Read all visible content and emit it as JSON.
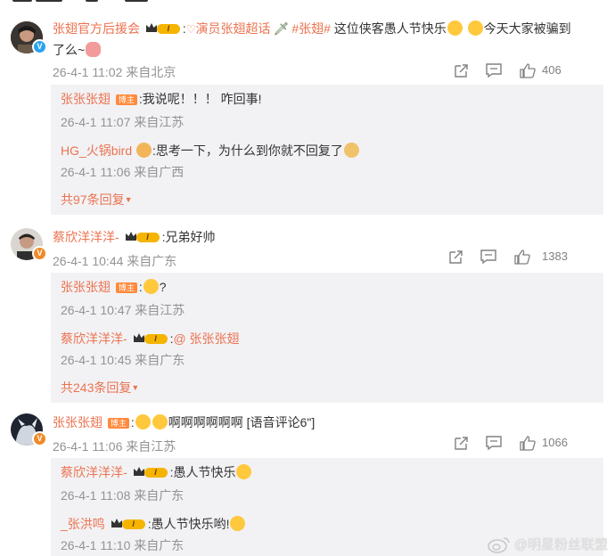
{
  "comments": [
    {
      "user": "张翅官方后援会",
      "text_parts": {
        "colon": ":",
        "tag1": "演员张翅超话",
        "tag2": "#张翅#",
        "t1": " 这位侠客愚人节快乐",
        "t2": "今天大家被骗到",
        "t3": "了么~"
      },
      "time": "26-4-1 11:02",
      "location": "来自北京",
      "likes": "406",
      "replies": [
        {
          "user": "张张张翅",
          "badge": "博主",
          "text": ":我说呢！！！ 咋回事!",
          "time": "26-4-1 11:07",
          "location": "来自江苏"
        },
        {
          "user": "HG_火锅bird",
          "text": ":思考一下，为什么到你就不回复了",
          "time": "26-4-1 11:06",
          "location": "来自广西"
        }
      ],
      "more": "共97条回复"
    },
    {
      "user": "蔡欣洋洋洋-",
      "text": ":兄弟好帅",
      "time": "26-4-1 10:44",
      "location": "来自广东",
      "likes": "1383",
      "replies": [
        {
          "user": "张张张翅",
          "badge": "博主",
          "text_a": ":",
          "text_b": "?",
          "time": "26-4-1 10:47",
          "location": "来自江苏"
        },
        {
          "user": "蔡欣洋洋洋-",
          "text_a": ":",
          "mention": "@ 张张张翅",
          "time": "26-4-1 10:45",
          "location": "来自广东"
        }
      ],
      "more": "共243条回复"
    },
    {
      "user": "张张张翅",
      "badge": "博主",
      "text_a": ":",
      "text_b": "啊啊啊啊啊啊 [语音评论6\"]",
      "time": "26-4-1 11:06",
      "location": "来自江苏",
      "likes": "1066",
      "replies": [
        {
          "user": "蔡欣洋洋洋-",
          "text": ":愚人节快乐",
          "time": "26-4-1 11:08",
          "location": "来自广东"
        },
        {
          "user": "_张洪鸣",
          "text": ":愚人节快乐哟!",
          "time": "26-4-1 11:10",
          "location": "来自广东"
        }
      ]
    }
  ],
  "rank_label": "I",
  "more_arrow": "▼",
  "watermark": "@明星粉丝联盟",
  "colors": {
    "accent": "#eb7350",
    "meta": "#939393",
    "bg": "#ffffff",
    "rank": "#f5b400"
  },
  "icons": [
    "share-icon",
    "comment-icon",
    "like-icon",
    "crown-icon",
    "verified-icon",
    "weibo-logo-icon",
    "emoji-icon"
  ]
}
